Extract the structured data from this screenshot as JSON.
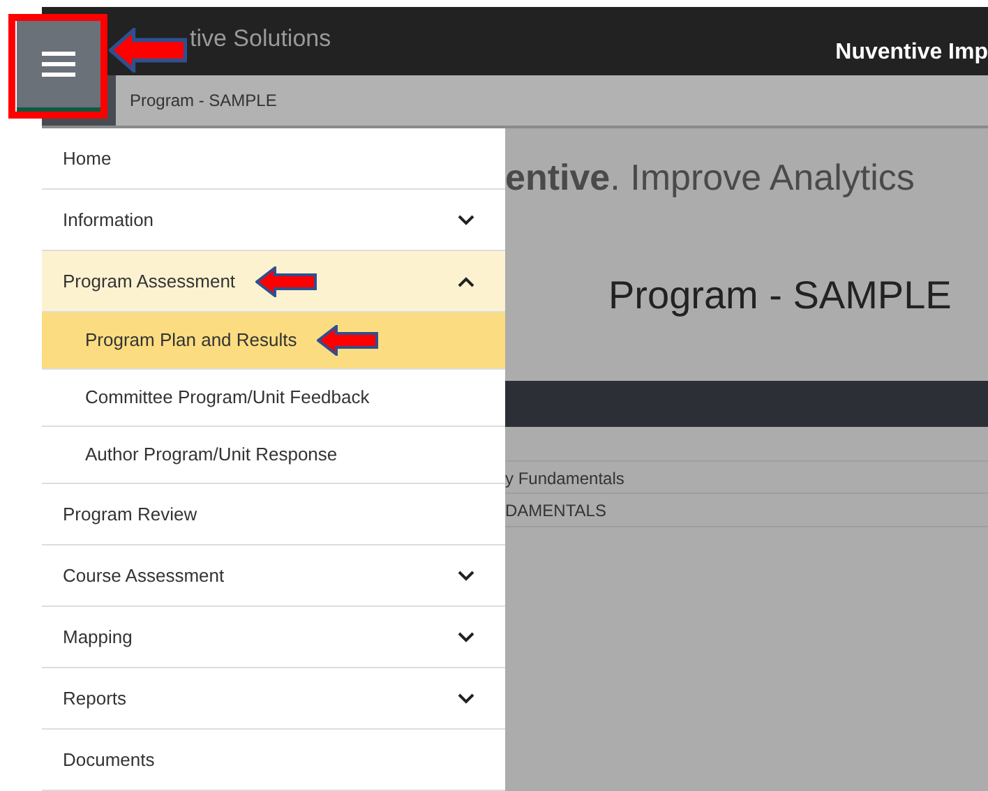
{
  "header": {
    "menu_button": {
      "highlighted": true,
      "pointed": true
    },
    "brand": "tive Solutions",
    "app_title": "Nuventive Imp"
  },
  "breadcrumb": "Program - SAMPLE",
  "menu": [
    {
      "label": "Home",
      "kind": "link",
      "selected": false,
      "pointed": false
    },
    {
      "label": "Information",
      "kind": "group",
      "expanded": false,
      "selected": false,
      "pointed": false
    },
    {
      "label": "Program Assessment",
      "kind": "group",
      "expanded": true,
      "selected": false,
      "pointed": true,
      "children": [
        {
          "label": "Program Plan and Results",
          "selected": true,
          "pointed": true
        },
        {
          "label": "Committee Program/Unit Feedback",
          "selected": false,
          "pointed": false
        },
        {
          "label": "Author Program/Unit Response",
          "selected": false,
          "pointed": false
        }
      ]
    },
    {
      "label": "Program Review",
      "kind": "link",
      "selected": false,
      "pointed": false
    },
    {
      "label": "Course Assessment",
      "kind": "group",
      "expanded": false,
      "selected": false,
      "pointed": false
    },
    {
      "label": "Mapping",
      "kind": "group",
      "expanded": false,
      "selected": false,
      "pointed": false
    },
    {
      "label": "Reports",
      "kind": "group",
      "expanded": false,
      "selected": false,
      "pointed": false
    },
    {
      "label": "Documents",
      "kind": "link",
      "selected": false,
      "pointed": false
    }
  ],
  "page": {
    "logo": "**entive**. Improve Analytics",
    "title": "Program - SAMPLE",
    "rows": [
      "y Fundamentals",
      "DAMENTALS"
    ]
  }
}
